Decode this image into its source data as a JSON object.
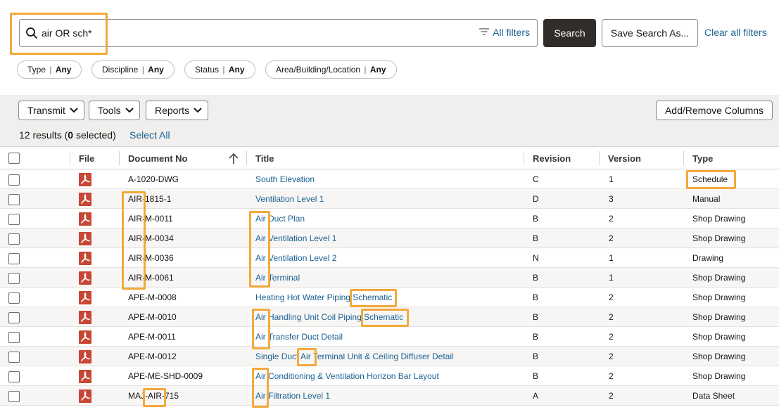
{
  "search": {
    "query": "air OR sch*",
    "all_filters_label": "All filters",
    "search_label": "Search",
    "save_label": "Save Search As...",
    "clear_label": "Clear all filters"
  },
  "chips": [
    {
      "name": "Type",
      "value": "Any"
    },
    {
      "name": "Discipline",
      "value": "Any"
    },
    {
      "name": "Status",
      "value": "Any"
    },
    {
      "name": "Area/Building/Location",
      "value": "Any"
    }
  ],
  "toolbar": {
    "transmit": "Transmit",
    "tools": "Tools",
    "reports": "Reports",
    "add_remove": "Add/Remove Columns",
    "select_all": "Select All"
  },
  "results": {
    "count": "12",
    "results_word": "results (",
    "selected": "0",
    "selected_word": " selected)"
  },
  "columns": {
    "file": "File",
    "doc_no": "Document No",
    "title": "Title",
    "revision": "Revision",
    "version": "Version",
    "type": "Type"
  },
  "rows": [
    {
      "doc_no": "A-1020-DWG",
      "title": "South Elevation",
      "revision": "C",
      "version": "1",
      "type": "Schedule"
    },
    {
      "doc_no": "AIR-1815-1",
      "title": "Ventilation Level 1",
      "revision": "D",
      "version": "3",
      "type": "Manual"
    },
    {
      "doc_no": "AIR-M-0011",
      "title": "Air Duct Plan",
      "revision": "B",
      "version": "2",
      "type": "Shop Drawing"
    },
    {
      "doc_no": "AIR-M-0034",
      "title": "Air Ventilation Level 1",
      "revision": "B",
      "version": "2",
      "type": "Shop Drawing"
    },
    {
      "doc_no": "AIR-M-0036",
      "title": "Air Ventilation Level 2",
      "revision": "N",
      "version": "1",
      "type": "Drawing"
    },
    {
      "doc_no": "AIR-M-0061",
      "title": "Air Terminal",
      "revision": "B",
      "version": "1",
      "type": "Shop Drawing"
    },
    {
      "doc_no": "APE-M-0008",
      "title": "Heating Hot Water Piping Schematic",
      "revision": "B",
      "version": "2",
      "type": "Shop Drawing"
    },
    {
      "doc_no": "APE-M-0010",
      "title": "Air Handling Unit Coil Piping Schematic",
      "revision": "B",
      "version": "2",
      "type": "Shop Drawing"
    },
    {
      "doc_no": "APE-M-0011",
      "title": "Air Transfer Duct Detail",
      "revision": "B",
      "version": "2",
      "type": "Shop Drawing"
    },
    {
      "doc_no": "APE-M-0012",
      "title": "Single Duct Air Terminal Unit & Ceiling Diffuser Detail",
      "revision": "B",
      "version": "2",
      "type": "Shop Drawing"
    },
    {
      "doc_no": "APE-ME-SHD-0009",
      "title": "Air Conditioning & Ventilation Horizon Bar Layout",
      "revision": "B",
      "version": "2",
      "type": "Shop Drawing"
    },
    {
      "doc_no": "MAJ-AIR-715",
      "title": "Air Filtration Level 1",
      "revision": "A",
      "version": "2",
      "type": "Data Sheet"
    }
  ],
  "icons": {
    "search": "search-icon",
    "filter": "filter-icon",
    "chevron": "chevron-down-icon",
    "pdf": "pdf-file-icon",
    "sort": "sort-ascending-icon"
  },
  "colors": {
    "highlight": "#f2a93b",
    "link": "#1b6193",
    "primary_button": "#312d2a",
    "pdf_red": "#c74634"
  }
}
